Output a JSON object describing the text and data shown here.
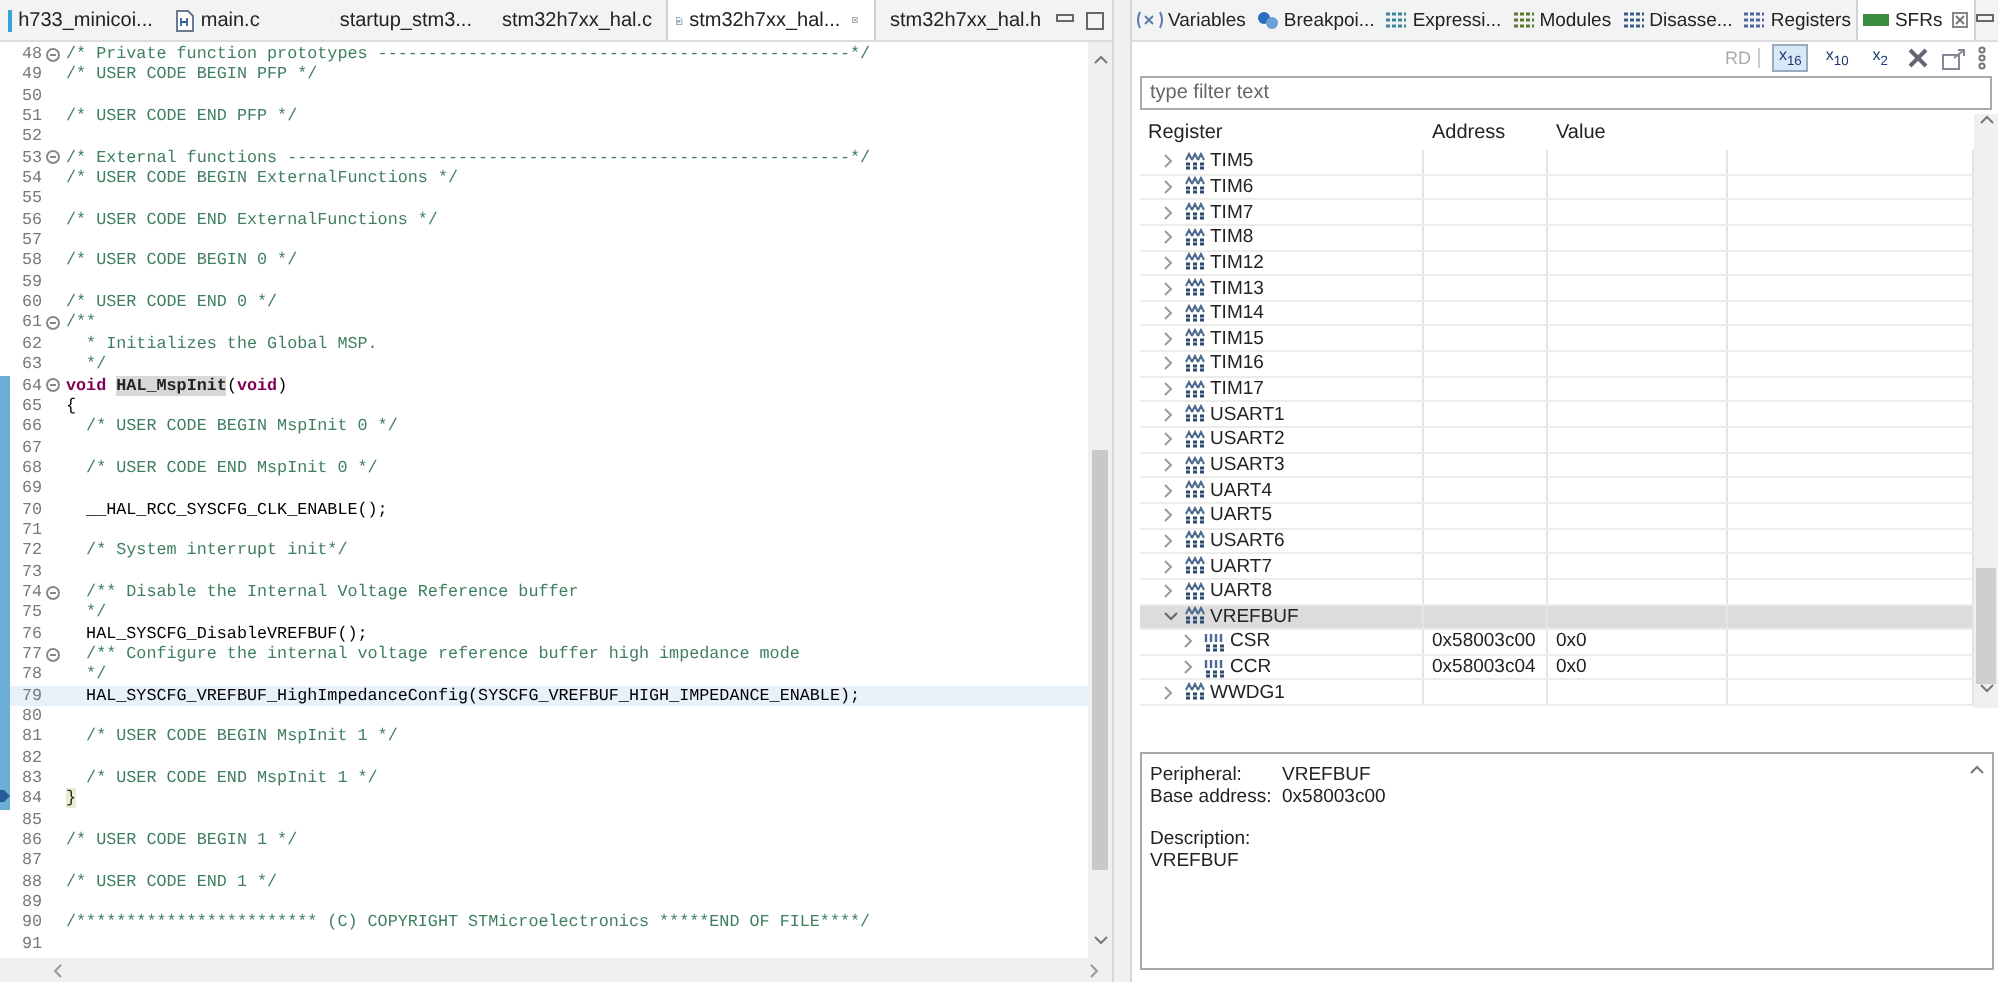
{
  "editor": {
    "tabs": [
      {
        "label": "h733_minicoi...",
        "kind": "mx",
        "selected": false
      },
      {
        "label": "main.c",
        "kind": "c",
        "selected": false
      },
      {
        "label": "startup_stm3...",
        "kind": "s",
        "selected": false
      },
      {
        "label": "stm32h7xx_hal.c",
        "kind": "c",
        "selected": false
      },
      {
        "label": "stm32h7xx_hal...",
        "kind": "c",
        "selected": true
      },
      {
        "label": "stm32h7xx_hal.h",
        "kind": "h",
        "selected": false
      }
    ],
    "lines": [
      {
        "number": "48",
        "fold": true,
        "scope": false,
        "current": false,
        "pointer": false,
        "tokens": [
          {
            "kind": "comment",
            "text": "/* Private function prototypes -----------------------------------------------*/"
          }
        ]
      },
      {
        "number": "49",
        "fold": false,
        "scope": false,
        "current": false,
        "pointer": false,
        "tokens": [
          {
            "kind": "comment",
            "text": "/* USER CODE BEGIN PFP */"
          }
        ]
      },
      {
        "number": "50",
        "fold": false,
        "scope": false,
        "current": false,
        "pointer": false
      },
      {
        "number": "51",
        "fold": false,
        "scope": false,
        "current": false,
        "pointer": false,
        "tokens": [
          {
            "kind": "comment",
            "text": "/* USER CODE END PFP */"
          }
        ]
      },
      {
        "number": "52",
        "fold": false,
        "scope": false,
        "current": false,
        "pointer": false
      },
      {
        "number": "53",
        "fold": true,
        "scope": false,
        "current": false,
        "pointer": false,
        "tokens": [
          {
            "kind": "comment",
            "text": "/* External functions --------------------------------------------------------*/"
          }
        ]
      },
      {
        "number": "54",
        "fold": false,
        "scope": false,
        "current": false,
        "pointer": false,
        "tokens": [
          {
            "kind": "comment",
            "text": "/* USER CODE BEGIN ExternalFunctions */"
          }
        ]
      },
      {
        "number": "55",
        "fold": false,
        "scope": false,
        "current": false,
        "pointer": false
      },
      {
        "number": "56",
        "fold": false,
        "scope": false,
        "current": false,
        "pointer": false,
        "tokens": [
          {
            "kind": "comment",
            "text": "/* USER CODE END ExternalFunctions */"
          }
        ]
      },
      {
        "number": "57",
        "fold": false,
        "scope": false,
        "current": false,
        "pointer": false
      },
      {
        "number": "58",
        "fold": false,
        "scope": false,
        "current": false,
        "pointer": false,
        "tokens": [
          {
            "kind": "comment",
            "text": "/* USER CODE BEGIN 0 */"
          }
        ]
      },
      {
        "number": "59",
        "fold": false,
        "scope": false,
        "current": false,
        "pointer": false
      },
      {
        "number": "60",
        "fold": false,
        "scope": false,
        "current": false,
        "pointer": false,
        "tokens": [
          {
            "kind": "comment",
            "text": "/* USER CODE END 0 */"
          }
        ]
      },
      {
        "number": "61",
        "fold": true,
        "scope": false,
        "current": false,
        "pointer": false,
        "tokens": [
          {
            "kind": "comment",
            "text": "/**"
          }
        ]
      },
      {
        "number": "62",
        "fold": false,
        "scope": false,
        "current": false,
        "pointer": false,
        "tokens": [
          {
            "kind": "comment",
            "text": "  * Initializes the Global MSP."
          }
        ]
      },
      {
        "number": "63",
        "fold": false,
        "scope": false,
        "current": false,
        "pointer": false,
        "tokens": [
          {
            "kind": "comment",
            "text": "  */"
          }
        ]
      },
      {
        "number": "64",
        "fold": true,
        "scope": true,
        "current": false,
        "pointer": false,
        "tokens": [
          {
            "kind": "keyword",
            "text": "void "
          },
          {
            "kind": "function",
            "text": "HAL_MspInit"
          },
          {
            "kind": "plain",
            "text": "("
          },
          {
            "kind": "keyword",
            "text": "void"
          },
          {
            "kind": "plain",
            "text": ")"
          }
        ]
      },
      {
        "number": "65",
        "fold": false,
        "scope": true,
        "current": false,
        "pointer": false,
        "tokens": [
          {
            "kind": "plain",
            "text": "{"
          }
        ]
      },
      {
        "number": "66",
        "fold": false,
        "scope": true,
        "current": false,
        "pointer": false,
        "tokens": [
          {
            "kind": "comment",
            "text": "  /* USER CODE BEGIN MspInit 0 */"
          }
        ]
      },
      {
        "number": "67",
        "fold": false,
        "scope": true,
        "current": false,
        "pointer": false
      },
      {
        "number": "68",
        "fold": false,
        "scope": true,
        "current": false,
        "pointer": false,
        "tokens": [
          {
            "kind": "comment",
            "text": "  /* USER CODE END MspInit 0 */"
          }
        ]
      },
      {
        "number": "69",
        "fold": false,
        "scope": true,
        "current": false,
        "pointer": false
      },
      {
        "number": "70",
        "fold": false,
        "scope": true,
        "current": false,
        "pointer": false,
        "tokens": [
          {
            "kind": "plain",
            "text": "  __HAL_RCC_SYSCFG_CLK_ENABLE();"
          }
        ]
      },
      {
        "number": "71",
        "fold": false,
        "scope": true,
        "current": false,
        "pointer": false
      },
      {
        "number": "72",
        "fold": false,
        "scope": true,
        "current": false,
        "pointer": false,
        "tokens": [
          {
            "kind": "comment",
            "text": "  /* System interrupt init*/"
          }
        ]
      },
      {
        "number": "73",
        "fold": false,
        "scope": true,
        "current": false,
        "pointer": false
      },
      {
        "number": "74",
        "fold": true,
        "scope": true,
        "current": false,
        "pointer": false,
        "tokens": [
          {
            "kind": "comment",
            "text": "  /** Disable the Internal Voltage Reference buffer"
          }
        ]
      },
      {
        "number": "75",
        "fold": false,
        "scope": true,
        "current": false,
        "pointer": false,
        "tokens": [
          {
            "kind": "comment",
            "text": "  */"
          }
        ]
      },
      {
        "number": "76",
        "fold": false,
        "scope": true,
        "current": false,
        "pointer": false,
        "tokens": [
          {
            "kind": "plain",
            "text": "  HAL_SYSCFG_DisableVREFBUF();"
          }
        ]
      },
      {
        "number": "77",
        "fold": true,
        "scope": true,
        "current": false,
        "pointer": false,
        "tokens": [
          {
            "kind": "comment",
            "text": "  /** Configure the internal voltage reference buffer high impedance mode"
          }
        ]
      },
      {
        "number": "78",
        "fold": false,
        "scope": true,
        "current": false,
        "pointer": false,
        "tokens": [
          {
            "kind": "comment",
            "text": "  */"
          }
        ]
      },
      {
        "number": "79",
        "fold": false,
        "scope": true,
        "current": true,
        "pointer": false,
        "tokens": [
          {
            "kind": "plain",
            "text": "  HAL_SYSCFG_VREFBUF_HighImpedanceConfig(SYSCFG_VREFBUF_HIGH_IMPEDANCE_ENABLE);"
          }
        ]
      },
      {
        "number": "80",
        "fold": false,
        "scope": true,
        "current": false,
        "pointer": false
      },
      {
        "number": "81",
        "fold": false,
        "scope": true,
        "current": false,
        "pointer": false,
        "tokens": [
          {
            "kind": "comment",
            "text": "  /* USER CODE BEGIN MspInit 1 */"
          }
        ]
      },
      {
        "number": "82",
        "fold": false,
        "scope": true,
        "current": false,
        "pointer": false
      },
      {
        "number": "83",
        "fold": false,
        "scope": true,
        "current": false,
        "pointer": false,
        "tokens": [
          {
            "kind": "comment",
            "text": "  /* USER CODE END MspInit 1 */"
          }
        ]
      },
      {
        "number": "84",
        "fold": false,
        "scope": true,
        "current": false,
        "pointer": true,
        "tokens": [
          {
            "kind": "brace",
            "text": "}"
          }
        ]
      },
      {
        "number": "85",
        "fold": false,
        "scope": false,
        "current": false,
        "pointer": false
      },
      {
        "number": "86",
        "fold": false,
        "scope": false,
        "current": false,
        "pointer": false,
        "tokens": [
          {
            "kind": "comment",
            "text": "/* USER CODE BEGIN 1 */"
          }
        ]
      },
      {
        "number": "87",
        "fold": false,
        "scope": false,
        "current": false,
        "pointer": false
      },
      {
        "number": "88",
        "fold": false,
        "scope": false,
        "current": false,
        "pointer": false,
        "tokens": [
          {
            "kind": "comment",
            "text": "/* USER CODE END 1 */"
          }
        ]
      },
      {
        "number": "89",
        "fold": false,
        "scope": false,
        "current": false,
        "pointer": false
      },
      {
        "number": "90",
        "fold": false,
        "scope": false,
        "current": false,
        "pointer": false,
        "tokens": [
          {
            "kind": "comment",
            "text": "/************************ (C) COPYRIGHT STMicroelectronics *****END OF FILE****/"
          }
        ]
      },
      {
        "number": "91",
        "fold": false,
        "scope": false,
        "current": false,
        "pointer": false
      }
    ]
  },
  "view": {
    "tabs": [
      {
        "label": "Variables",
        "kind": "variables",
        "selected": false
      },
      {
        "label": "Breakpoi...",
        "kind": "breakpoints",
        "selected": false
      },
      {
        "label": "Expressi...",
        "kind": "expressions",
        "selected": false
      },
      {
        "label": "Modules",
        "kind": "modules",
        "selected": false
      },
      {
        "label": "Disasse...",
        "kind": "disassembly",
        "selected": false
      },
      {
        "label": "Registers",
        "kind": "registers",
        "selected": false
      },
      {
        "label": "SFRs",
        "kind": "sfrs",
        "selected": true
      }
    ],
    "toolbar": {
      "read_button": "RD",
      "formats": [
        {
          "label": "x$_{16}$",
          "selected": true
        },
        {
          "label": "x$_{10}$",
          "selected": false
        },
        {
          "label": "x$_{2}$",
          "selected": false
        }
      ]
    },
    "filter": {
      "placeholder": "type filter text"
    },
    "columns": [
      "Register",
      "Address",
      "Value"
    ],
    "rows": [
      {
        "name": "TIM5",
        "kind": "peripheral",
        "expanded": false,
        "selected": false
      },
      {
        "name": "TIM6",
        "kind": "peripheral",
        "expanded": false,
        "selected": false
      },
      {
        "name": "TIM7",
        "kind": "peripheral",
        "expanded": false,
        "selected": false
      },
      {
        "name": "TIM8",
        "kind": "peripheral",
        "expanded": false,
        "selected": false
      },
      {
        "name": "TIM12",
        "kind": "peripheral",
        "expanded": false,
        "selected": false
      },
      {
        "name": "TIM13",
        "kind": "peripheral",
        "expanded": false,
        "selected": false
      },
      {
        "name": "TIM14",
        "kind": "peripheral",
        "expanded": false,
        "selected": false
      },
      {
        "name": "TIM15",
        "kind": "peripheral",
        "expanded": false,
        "selected": false
      },
      {
        "name": "TIM16",
        "kind": "peripheral",
        "expanded": false,
        "selected": false
      },
      {
        "name": "TIM17",
        "kind": "peripheral",
        "expanded": false,
        "selected": false
      },
      {
        "name": "USART1",
        "kind": "peripheral",
        "expanded": false,
        "selected": false
      },
      {
        "name": "USART2",
        "kind": "peripheral",
        "expanded": false,
        "selected": false
      },
      {
        "name": "USART3",
        "kind": "peripheral",
        "expanded": false,
        "selected": false
      },
      {
        "name": "UART4",
        "kind": "peripheral",
        "expanded": false,
        "selected": false
      },
      {
        "name": "UART5",
        "kind": "peripheral",
        "expanded": false,
        "selected": false
      },
      {
        "name": "USART6",
        "kind": "peripheral",
        "expanded": false,
        "selected": false
      },
      {
        "name": "UART7",
        "kind": "peripheral",
        "expanded": false,
        "selected": false
      },
      {
        "name": "UART8",
        "kind": "peripheral",
        "expanded": false,
        "selected": false
      },
      {
        "name": "VREFBUF",
        "kind": "peripheral",
        "expanded": true,
        "selected": true,
        "children": [
          {
            "name": "CSR",
            "kind": "register",
            "expanded": false,
            "selected": false,
            "address": "0x58003c00",
            "value": "0x0"
          },
          {
            "name": "CCR",
            "kind": "register",
            "expanded": false,
            "selected": false,
            "address": "0x58003c04",
            "value": "0x0"
          }
        ]
      },
      {
        "name": "WWDG1",
        "kind": "peripheral",
        "expanded": false,
        "selected": false
      }
    ],
    "details": [
      {
        "label": "Peripheral:",
        "value": "VREFBUF"
      },
      {
        "label": "Base address:",
        "value": "0x58003c00"
      }
    ],
    "description": {
      "label": "Description:",
      "text": "VREFBUF"
    }
  }
}
